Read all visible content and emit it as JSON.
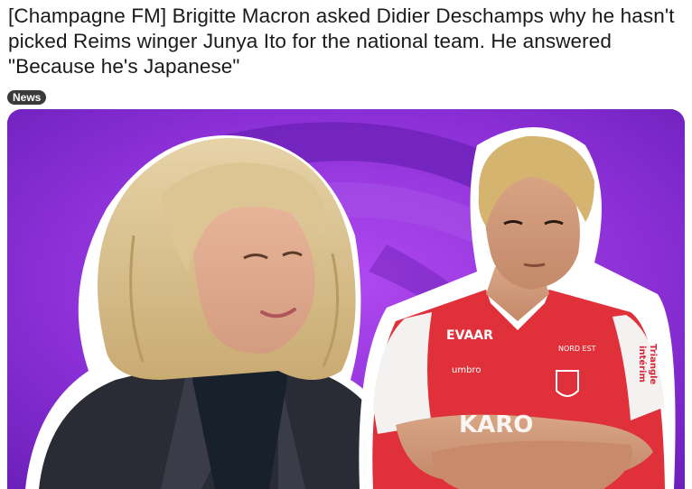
{
  "post": {
    "title": "[Champagne FM] Brigitte Macron asked Didier Deschamps why he hasn't picked Reims winger Junya Ito for the national team. He answered \"Because he's Japanese\"",
    "flair": "News"
  },
  "image": {
    "description_icons": [
      "woman-portrait",
      "footballer-portrait"
    ],
    "jersey": {
      "sponsor_left": "EVAAR",
      "kit_brand": "umbro",
      "sponsor_right": "NORD EST",
      "side_text_1": "Triangle",
      "side_text_2": "intérim",
      "chest": "KARO"
    },
    "colors": {
      "background": "#8a2fd6",
      "jersey_red": "#e0303a",
      "jersey_white": "#f4f1f1"
    }
  }
}
